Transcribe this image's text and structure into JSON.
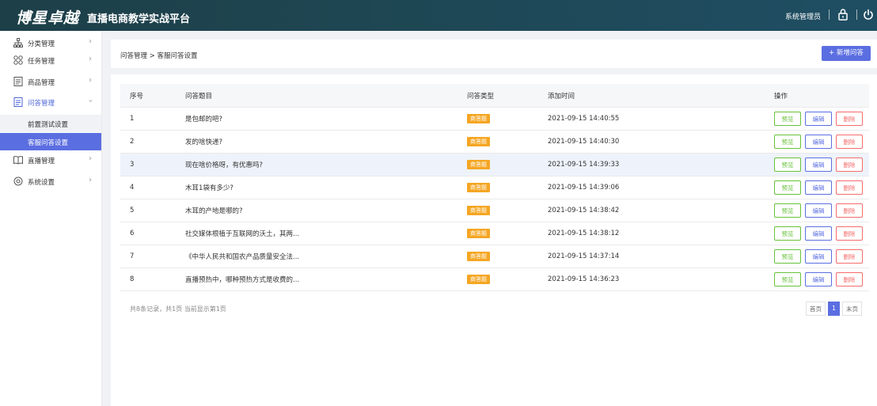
{
  "header": {
    "logo": "博星卓越",
    "platform_title": "直播电商教学实战平台",
    "user": "系统管理员",
    "lock_icon": "lock-icon",
    "power_icon": "power-icon"
  },
  "sidebar": {
    "items": [
      {
        "label": "分类管理",
        "icon": "org-tree-icon"
      },
      {
        "label": "任务管理",
        "icon": "grid-icon"
      },
      {
        "label": "商品管理",
        "icon": "list-icon"
      },
      {
        "label": "问答管理",
        "icon": "qa-icon"
      },
      {
        "label": "直播管理",
        "icon": "book-icon"
      },
      {
        "label": "系统设置",
        "icon": "settings-icon"
      }
    ],
    "sub_items": [
      {
        "label": "前置测试设置"
      },
      {
        "label": "客服问答设置"
      }
    ]
  },
  "breadcrumb": "问答管理 > 客服问答设置",
  "add_button": "+ 新增问答",
  "table": {
    "headers": [
      "序号",
      "问答题目",
      "问答类型",
      "添加时间",
      "操作"
    ],
    "actions": {
      "preview": "预览",
      "edit": "编辑",
      "delete": "删除"
    },
    "rows": [
      {
        "no": "1",
        "question": "是包邮的吧?",
        "type": "商答题",
        "time": "2021-09-15 14:40:55"
      },
      {
        "no": "2",
        "question": "发的啥快递?",
        "type": "商答题",
        "time": "2021-09-15 14:40:30"
      },
      {
        "no": "3",
        "question": "现在啥价格呀，有优惠吗?",
        "type": "商答题",
        "time": "2021-09-15 14:39:33"
      },
      {
        "no": "4",
        "question": "木耳1袋有多少?",
        "type": "商答题",
        "time": "2021-09-15 14:39:06"
      },
      {
        "no": "5",
        "question": "木耳的产地是哪的?",
        "type": "商答题",
        "time": "2021-09-15 14:38:42"
      },
      {
        "no": "6",
        "question": "社交媒体根植于互联网的沃土，其两...",
        "type": "商答题",
        "time": "2021-09-15 14:38:12"
      },
      {
        "no": "7",
        "question": "《中华人民共和国农产品质量安全法...",
        "type": "商答题",
        "time": "2021-09-15 14:37:14"
      },
      {
        "no": "8",
        "question": "直播预热中，哪种预热方式是收费的...",
        "type": "商答题",
        "time": "2021-09-15 14:36:23"
      }
    ]
  },
  "pagination": {
    "summary": "共8条记录，共1页 当前显示第1页",
    "first": "首页",
    "current": "1",
    "last": "末页"
  },
  "colors": {
    "accent": "#5b6ee1",
    "header_bg": "#1e4652",
    "badge": "#f5a623",
    "preview": "#67c23a",
    "delete": "#f56c6c"
  }
}
